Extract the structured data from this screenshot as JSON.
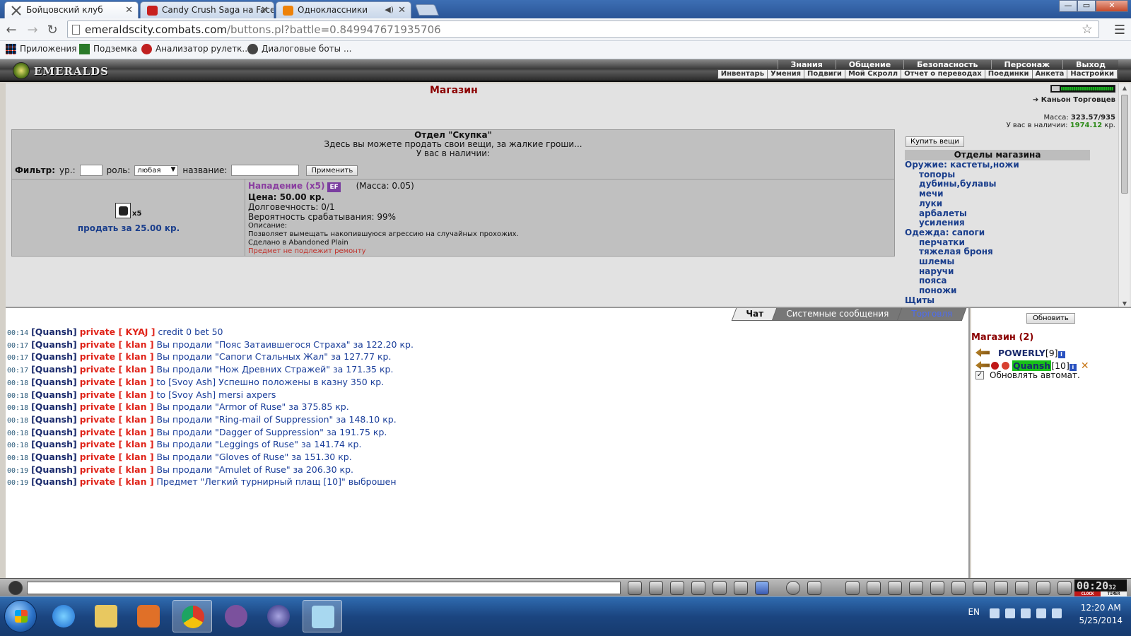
{
  "browser": {
    "tabs": [
      {
        "title": "Бойцовский клуб",
        "active": true
      },
      {
        "title": "Candy Crush Saga на Face",
        "active": false
      },
      {
        "title": "Одноклассники",
        "active": false
      }
    ],
    "url_host": "emeraldscity.combats.com",
    "url_path": "/buttons.pl?battle=0.849947671935706",
    "bookmarks": [
      "Приложения",
      "Подземка",
      "Анализатор рулетк...",
      "Диалоговые боты ..."
    ]
  },
  "game": {
    "logo_text": "EMERALDS",
    "top_menu": [
      "Знания",
      "Общение",
      "Безопасность",
      "Персонаж",
      "Выход"
    ],
    "sub_menu": [
      "Инвентарь",
      "Умения",
      "Подвиги",
      "Мой Скролл",
      "Отчет о переводах",
      "Поединки",
      "Анкета",
      "Настройки"
    ]
  },
  "shop": {
    "title": "Магазин",
    "location": "Каньон Торговцев",
    "mass_label": "Масса:",
    "mass_value": "323.57/935",
    "money_label": "У вас в наличии:",
    "money_value": "1974.12",
    "money_unit": "кр.",
    "dept_title": "Отдел \"Скупка\"",
    "dept_subtitle": "Здесь вы можете продать свои вещи, за жалкие гроши...",
    "dept_have": "У вас в наличии:",
    "filter": {
      "label": "Фильтр:",
      "level_label": "ур.:",
      "role_label": "роль:",
      "role_value": "любая",
      "name_label": "название:",
      "apply": "Применить"
    },
    "item": {
      "count_badge": "x5",
      "sell_label": "продать за 25.00 кр.",
      "name": "Нападение (x5)",
      "badge": "EF",
      "mass": "(Масса: 0.05)",
      "price": "Цена: 50.00 кр.",
      "durability": "Долговечность: 0/1",
      "chance": "Вероятность срабатывания: 99%",
      "desc_label": "Описание:",
      "desc": "Позволяет вымещать накопившуюся агрессию на случайных прохожих.",
      "made": "Сделано в Abandoned Plain",
      "no_repair": "Предмет не подлежит ремонту"
    },
    "buy_button": "Купить вещи",
    "departments_title": "Отделы магазина",
    "departments": [
      {
        "label": "Оружие: кастеты,ножи",
        "sub": false
      },
      {
        "label": "топоры",
        "sub": true
      },
      {
        "label": "дубины,булавы",
        "sub": true
      },
      {
        "label": "мечи",
        "sub": true
      },
      {
        "label": "луки",
        "sub": true
      },
      {
        "label": "арбалеты",
        "sub": true
      },
      {
        "label": "усиления",
        "sub": true
      },
      {
        "label": "Одежда: сапоги",
        "sub": false
      },
      {
        "label": "перчатки",
        "sub": true
      },
      {
        "label": "тяжелая броня",
        "sub": true
      },
      {
        "label": "шлемы",
        "sub": true
      },
      {
        "label": "наручи",
        "sub": true
      },
      {
        "label": "пояса",
        "sub": true
      },
      {
        "label": "поножи",
        "sub": true
      },
      {
        "label": "Щиты",
        "sub": false
      }
    ]
  },
  "chat": {
    "tabs": [
      "Чат",
      "Системные сообщения",
      "Торговля"
    ],
    "messages": [
      {
        "time": "00:14",
        "nick": "[Quansh]",
        "private": "private [ KYAJ ]",
        "text": "credit 0 bet 50"
      },
      {
        "time": "00:17",
        "nick": "[Quansh]",
        "private": "private [ klan ]",
        "text": "Вы продали \"Пояс Затаившегося Страха\" за 122.20 кр."
      },
      {
        "time": "00:17",
        "nick": "[Quansh]",
        "private": "private [ klan ]",
        "text": "Вы продали \"Сапоги Стальных Жал\" за 127.77 кр."
      },
      {
        "time": "00:17",
        "nick": "[Quansh]",
        "private": "private [ klan ]",
        "text": "Вы продали \"Нож Древних Стражей\" за 171.35 кр."
      },
      {
        "time": "00:18",
        "nick": "[Quansh]",
        "private": "private [ klan ]",
        "text": "to [Svoy Ash] Успешно положены в казну 350 кр."
      },
      {
        "time": "00:18",
        "nick": "[Quansh]",
        "private": "private [ klan ]",
        "text": "to [Svoy Ash] mersi axpers"
      },
      {
        "time": "00:18",
        "nick": "[Quansh]",
        "private": "private [ klan ]",
        "text": "Вы продали \"Armor of Ruse\" за 375.85 кр."
      },
      {
        "time": "00:18",
        "nick": "[Quansh]",
        "private": "private [ klan ]",
        "text": "Вы продали \"Ring-mail of Suppression\" за 148.10 кр."
      },
      {
        "time": "00:18",
        "nick": "[Quansh]",
        "private": "private [ klan ]",
        "text": "Вы продали \"Dagger of Suppression\" за 191.75 кр."
      },
      {
        "time": "00:18",
        "nick": "[Quansh]",
        "private": "private [ klan ]",
        "text": "Вы продали \"Leggings of Ruse\" за 141.74 кр."
      },
      {
        "time": "00:18",
        "nick": "[Quansh]",
        "private": "private [ klan ]",
        "text": "Вы продали \"Gloves of Ruse\" за 151.30 кр."
      },
      {
        "time": "00:19",
        "nick": "[Quansh]",
        "private": "private [ klan ]",
        "text": "Вы продали \"Amulet of Ruse\" за 206.30 кр."
      },
      {
        "time": "00:19",
        "nick": "[Quansh]",
        "private": "private [ klan ]",
        "text": "Предмет \"Легкий турнирный плащ [10]\" выброшен"
      }
    ]
  },
  "users": {
    "refresh": "Обновить",
    "title": "Магазин (2)",
    "list": [
      {
        "name": "POWERLY",
        "level": "[9]"
      },
      {
        "name": "Quansh",
        "level": "[10]"
      }
    ],
    "auto_refresh": "Обновлять автомат."
  },
  "clock": {
    "time": "00:20",
    "sec": "32",
    "clock_label": "CLOCK",
    "timer_label": "TIMER"
  },
  "taskbar": {
    "lang": "EN",
    "time": "12:20 AM",
    "date": "5/25/2014"
  }
}
